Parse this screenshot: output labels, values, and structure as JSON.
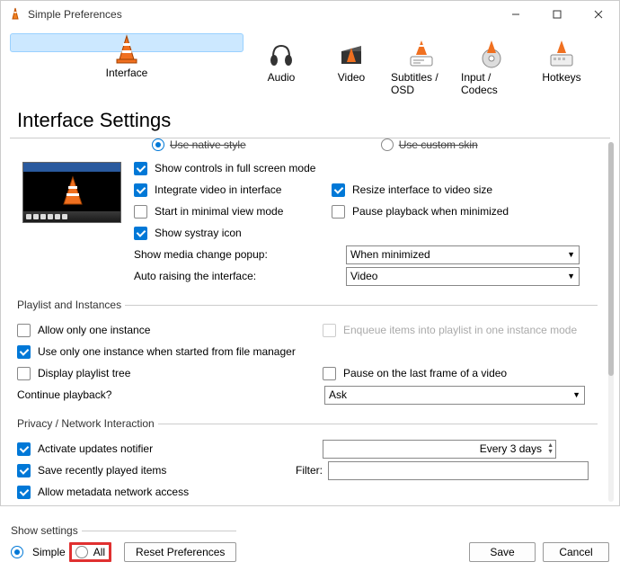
{
  "window": {
    "title": "Simple Preferences"
  },
  "tabs": [
    {
      "label": "Interface"
    },
    {
      "label": "Audio"
    },
    {
      "label": "Video"
    },
    {
      "label": "Subtitles / OSD"
    },
    {
      "label": "Input / Codecs"
    },
    {
      "label": "Hotkeys"
    }
  ],
  "heading": "Interface Settings",
  "style_radio": {
    "native": "Use native style",
    "custom": "Use custom skin"
  },
  "lookfeel": {
    "show_controls": "Show controls in full screen mode",
    "integrate": "Integrate video in interface",
    "resize": "Resize interface to video size",
    "minimal": "Start in minimal view mode",
    "pause_min": "Pause playback when minimized",
    "systray": "Show systray icon",
    "media_popup_lbl": "Show media change popup:",
    "media_popup_val": "When minimized",
    "auto_raise_lbl": "Auto raising the interface:",
    "auto_raise_val": "Video"
  },
  "playlist": {
    "legend": "Playlist and Instances",
    "one_instance": "Allow only one instance",
    "enqueue": "Enqueue items into playlist in one instance mode",
    "one_from_fm": "Use only one instance when started from file manager",
    "tree": "Display playlist tree",
    "pause_last": "Pause on the last frame of a video",
    "continue_lbl": "Continue playback?",
    "continue_val": "Ask"
  },
  "privacy": {
    "legend": "Privacy / Network Interaction",
    "updates": "Activate updates notifier",
    "update_freq": "Every 3 days",
    "recent": "Save recently played items",
    "filter_lbl": "Filter:",
    "metadata": "Allow metadata network access"
  },
  "footer": {
    "show_legend": "Show settings",
    "simple": "Simple",
    "all": "All",
    "reset": "Reset Preferences",
    "save": "Save",
    "cancel": "Cancel"
  }
}
